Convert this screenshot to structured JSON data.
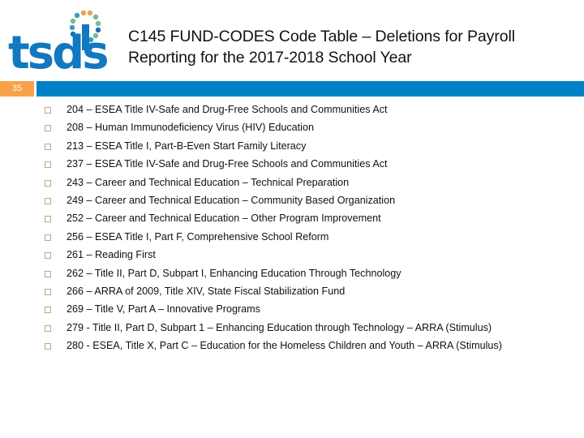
{
  "logo": {
    "text": "tsds",
    "color": "#1278c0",
    "dot_colors": [
      "#f0a050",
      "#3aa0b8",
      "#7ab89a",
      "#1a6fb0",
      "#f0a050",
      "#2aa6c0"
    ]
  },
  "header": {
    "title_line1": "C145 FUND-CODES Code Table – Deletions for Payroll",
    "title_line2": "Reporting for the 2017-2018 School Year"
  },
  "slide": {
    "number": "35",
    "number_bg": "#f7a24a",
    "band_color": "#0081c6"
  },
  "items": [
    {
      "text": "204 – ESEA Title IV-Safe and Drug-Free Schools and Communities Act"
    },
    {
      "text": "208 – Human Immunodeficiency Virus (HIV) Education"
    },
    {
      "text": "213 – ESEA Title I, Part-B-Even Start Family Literacy"
    },
    {
      "text": "237 – ESEA Title IV-Safe and Drug-Free Schools and Communities Act"
    },
    {
      "text": "243 – Career and Technical Education – Technical Preparation"
    },
    {
      "text": "249 – Career and Technical Education – Community Based Organization"
    },
    {
      "text": "252 – Career and Technical Education – Other Program Improvement"
    },
    {
      "text": "256 – ESEA Title I, Part F, Comprehensive School Reform"
    },
    {
      "text": "261 – Reading First"
    },
    {
      "text": "262 – Title II, Part D, Subpart I, Enhancing Education Through Technology"
    },
    {
      "text": "266 – ARRA of 2009, Title XIV, State Fiscal Stabilization Fund"
    },
    {
      "text": "269 – Title V, Part A – Innovative Programs"
    },
    {
      "text": "279 - Title II, Part D, Subpart 1 – Enhancing Education through Technology – ARRA (Stimulus)"
    },
    {
      "text": "280 - ESEA, Title X, Part C – Education for the Homeless Children and Youth – ARRA (Stimulus)"
    }
  ]
}
